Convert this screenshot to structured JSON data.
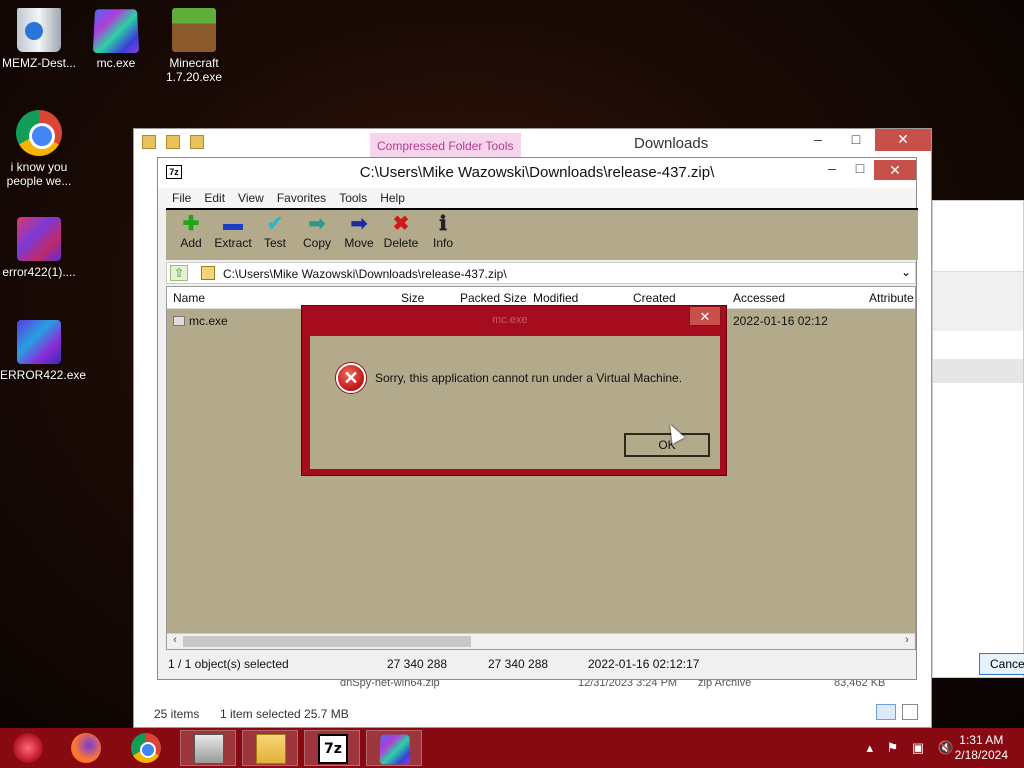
{
  "desktop": {
    "icons": [
      {
        "label": "MEMZ-Dest..."
      },
      {
        "label": "mc.exe"
      },
      {
        "label": "Minecraft 1.7.20.exe"
      },
      {
        "label": "i know you people we..."
      },
      {
        "label": "error422(1)...."
      },
      {
        "label": "ERROR422.exe"
      }
    ]
  },
  "explorer": {
    "ribbon_tab": "Compressed Folder Tools",
    "title": "Downloads",
    "peek_file": "dnSpy-net-win64.zip",
    "peek_date": "12/31/2023 3:24 PM",
    "peek_type": "zip Archive",
    "peek_size": "83,462 KB",
    "status_items": "25 items",
    "status_selected": "1 item selected  25.7 MB"
  },
  "background_dialog": {
    "cancel_label": "Cance"
  },
  "sevenzip": {
    "title": "C:\\Users\\Mike Wazowski\\Downloads\\release-437.zip\\",
    "menu": [
      "File",
      "Edit",
      "View",
      "Favorites",
      "Tools",
      "Help"
    ],
    "toolbar": [
      {
        "label": "Add",
        "glyph": "✚",
        "color": "#1aa51a"
      },
      {
        "label": "Extract",
        "glyph": "▬",
        "color": "#1c3fc4"
      },
      {
        "label": "Test",
        "glyph": "✔",
        "color": "#2bb7c8"
      },
      {
        "label": "Copy",
        "glyph": "➡",
        "color": "#2a9a8a"
      },
      {
        "label": "Move",
        "glyph": "➡",
        "color": "#1c2aa8"
      },
      {
        "label": "Delete",
        "glyph": "✖",
        "color": "#d01818"
      },
      {
        "label": "Info",
        "glyph": "ℹ",
        "color": "#222222"
      }
    ],
    "address": "C:\\Users\\Mike Wazowski\\Downloads\\release-437.zip\\",
    "columns": {
      "name": "Name",
      "size": "Size",
      "packed": "Packed Size",
      "modified": "Modified",
      "created": "Created",
      "accessed": "Accessed",
      "attributes": "Attribute"
    },
    "rows": [
      {
        "name": "mc.exe",
        "accessed": "2022-01-16 02:12"
      }
    ],
    "status": {
      "selected": "1 / 1 object(s) selected",
      "size": "27 340 288",
      "packed": "27 340 288",
      "date": "2022-01-16 02:12:17"
    }
  },
  "error_dialog": {
    "title": "mc.exe",
    "message": "Sorry, this application cannot run under a Virtual Machine.",
    "ok_label": "OK"
  },
  "taskbar": {
    "time": "1:31 AM",
    "date": "2/18/2024",
    "sevenzip_label": "7z"
  }
}
